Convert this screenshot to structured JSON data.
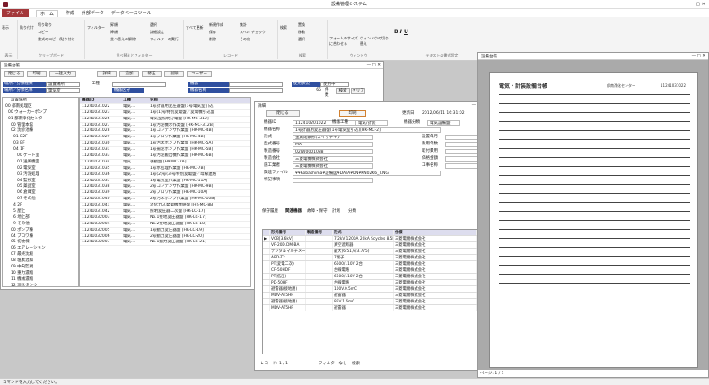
{
  "app": {
    "title": "設備管理システム"
  },
  "ribbon": {
    "tabs": [
      "ファイル",
      "ホーム",
      "作成",
      "外部データ",
      "データベースツール"
    ],
    "groups": [
      "表示",
      "クリップボード",
      "並べ替えとフィルター",
      "レコード",
      "検索",
      "ウィンドウ",
      "テキストの書式設定"
    ],
    "items": {
      "view": "表示",
      "paste": "貼り付け",
      "cut": "切り取り",
      "copy": "コピー",
      "format_painter": "書式のコピー/貼り付け",
      "filter": "フィルター",
      "ascending": "昇順",
      "descending": "降順",
      "remove_sort": "並べ替えの解除",
      "selection": "選択",
      "advanced": "詳細設定",
      "toggle_filter": "フィルターの実行",
      "refresh": "すべて更新",
      "new": "新規作成",
      "save": "保存",
      "delete": "削除",
      "totals": "集計",
      "spelling": "スペル チェック",
      "more": "その他",
      "find": "検索",
      "replace": "置換",
      "goto": "移動",
      "select": "選択",
      "fit_form": "フォームのサイズに合わせる",
      "switch_windows": "ウィンドウの切り替え"
    }
  },
  "status": {
    "text": "コマンドを入力してください。"
  },
  "list_window": {
    "title": "設備台帳",
    "buttons": [
      "閉じる",
      "印刷",
      "一括入力",
      "詳細",
      "追加",
      "修正",
      "削除",
      "ユーザー"
    ],
    "search": {
      "label1": "場所／分類種類",
      "value1": "設置場所",
      "label2": "場所／分類名称",
      "value2": "電気室",
      "label3": "工種",
      "value3": "",
      "label4": "機器",
      "label5": "機器区分",
      "label6": "機器名称",
      "label7": "使用状況",
      "value7": "使用中",
      "count_label": "件数",
      "count": "65",
      "btn_search": "検索",
      "btn_clear": "クリア"
    },
    "tree": [
      "設置場所",
      "00 都南処理区",
      "00 ウォーカーポンプ",
      "01 都南浄化センター",
      "00 管理本館",
      "02 沈砂池棟",
      "01 B2F",
      "03 BF",
      "04 1F",
      "00 ゲート室",
      "01 送風機室",
      "02 電気室",
      "03 汚泥処理",
      "04 監視室",
      "05 薬品室",
      "06 倉庫室",
      "07 その他",
      "4 2F",
      "5 屋上",
      "6 地上部",
      "9 その他",
      "00 ポンプ棟",
      "04 ブロワ棟",
      "05 初沈棟",
      "06 エアレーション",
      "07 最終沈殿",
      "08 塩素混和",
      "09 中央監視",
      "10 重力濃縮",
      "11 機械濃縮",
      "12 消化タンク"
    ],
    "grid_headers": [
      "機器ID",
      "工種",
      "名称"
    ],
    "grid": [
      [
        "11241031022",
        "電気...",
        "1号計器用変圧器盤(1号電気室引込)"
      ],
      [
        "11241031023",
        "電気...",
        "1号(1)号特別変電盤／変電機引込盤"
      ],
      [
        "11241031026",
        "電気...",
        "電気室照明分電盤 [HK-MC-312]"
      ],
      [
        "11241031027",
        "電気...",
        "1号汚泥機水作業盤 [HK-MC-312B]"
      ],
      [
        "11241031028",
        "電気...",
        "1号コンデンサ作業盤 [HK-MC-4B]"
      ],
      [
        "11241031029",
        "電気...",
        "1号ブロワ作業盤 [HK-MC-4B]"
      ],
      [
        "11241031030",
        "電気...",
        "1号汚水ポンプ作業盤 [HK-MC-5A]"
      ],
      [
        "11241031031",
        "電気...",
        "1号揚泥ポンプ作業盤 [HK-MC-5B]"
      ],
      [
        "11241031033",
        "電気...",
        "1号汚泥搬出機作業盤 [HK-MC-6B]"
      ],
      [
        "11241031034",
        "電気...",
        "手動盤 [HK-MC-7A]"
      ],
      [
        "11241031035",
        "電気...",
        "1号水処理作業盤 [HK-MC-7B]"
      ],
      [
        "11241031036",
        "電気...",
        "1号(2)号(3)号特別変電盤／母線連絡"
      ],
      [
        "11241031037",
        "電気...",
        "1号電気室作業盤 [HK-MC-11A]"
      ],
      [
        "11241031038",
        "電気...",
        "2号コンデンサ作業盤 [HK-MC-9B]"
      ],
      [
        "11241031039",
        "電気...",
        "2号ブロワ作業盤 [HK-MC-10A]"
      ],
      [
        "11241031040",
        "電気...",
        "2号汚水ポンプ作業盤 [HK-MC-10B]"
      ],
      [
        "11241031041",
        "電気...",
        "消化ガス発電機連絡盤 [HK-MC-8B]"
      ],
      [
        "11241031042",
        "電気...",
        "照明変圧器二次盤 [HK-LC-17]"
      ],
      [
        "11241032003",
        "電気...",
        "No.1接地変圧器盤 [HK-LC-17]"
      ],
      [
        "11241032004",
        "電気...",
        "No.2接地変圧器盤 [HK-LC-18]"
      ],
      [
        "11241032005",
        "電気...",
        "1号動力変圧器盤 [HK-LC-19]"
      ],
      [
        "11241032006",
        "電気...",
        "2号動力変圧器盤 [HK-LC-20]"
      ],
      [
        "11241032007",
        "電気...",
        "No.1動力変圧器盤 [HK-LC-21]"
      ]
    ]
  },
  "detail_window": {
    "title": "詳細",
    "close": "閉じる",
    "print": "印刷",
    "update": "更新日",
    "datetime": "2012/06/11 16:31:02",
    "fields": [
      [
        "機器ID",
        "112410201022"
      ],
      [
        "機器名称",
        "1号計器用変圧器盤(1号電気室引込)[HK-MC-2]"
      ],
      [
        "形式",
        "金属閉鎖形(スイッチギア"
      ],
      [
        "型式番号",
        "MX"
      ],
      [
        "製造番号",
        "02JW0001088"
      ],
      [
        "製造会社",
        "三菱電機株式会社"
      ],
      [
        "施工業者",
        "三菱電機株式会社"
      ],
      [
        "関連ファイル",
        "¥¥Kobashima¥設備図¥DATA¥KN¥KN02K6_T.NG"
      ],
      [
        "特記事項",
        ""
      ]
    ],
    "right_fields": [
      [
        "機器工種",
        "電気/計装"
      ],
      [
        "機器分類",
        "電気設備盤"
      ],
      [
        "設置年月",
        ""
      ],
      [
        "耐用年数",
        ""
      ],
      [
        "取付費用",
        ""
      ],
      [
        "価格金額",
        ""
      ],
      [
        "工事名称",
        ""
      ]
    ],
    "tabs": [
      "保守履歴",
      "関連機器",
      "故障・保守",
      "計測",
      "分類"
    ],
    "sub_headers": [
      "",
      "形式番号",
      "製造番号",
      "形式",
      "仕様",
      "製造会社"
    ],
    "sub_rows": [
      [
        "VCB[3.6kV]",
        "",
        "7.2kV 1200A 20kA Scycles 8.5kg",
        "三菱電機株式会社"
      ],
      [
        "VF-20D.DM-BA",
        "SR503",
        "真空遮断器",
        "三菱電機株式会社"
      ],
      [
        "デジタルマルチメータ",
        "",
        "最大(6/51,6/3.775)",
        "三菱電機株式会社"
      ],
      [
        "ARD-T2",
        "MP72",
        "7端子",
        "三菱電機株式会社"
      ],
      [
        "PT(変電二次)",
        "",
        "6600/110V 2台",
        "三菱電機株式会社"
      ],
      [
        "CF-50HDF",
        "45002/45006",
        "台線電路",
        "三菱電機株式会社"
      ],
      [
        "PT(低圧)",
        "",
        "6600/110V 2台",
        "三菱電機株式会社"
      ],
      [
        "PD-50HF",
        "45005/45106",
        "台線電路",
        "三菱電機株式会社"
      ],
      [
        "避雷器(接地用)",
        "",
        "100V.0.5mC",
        "三菱電機株式会社"
      ],
      [
        "MDV-AT5HR",
        "21PNEP23/136",
        "避雷器",
        "三菱電機株式会社"
      ],
      [
        "避雷器(接地用)",
        "",
        "85V.1.6mC",
        "三菱電機株式会社"
      ],
      [
        "MDV-AT5HR",
        "1940/15/164",
        "避雷器",
        "三菱電機株式会社"
      ]
    ],
    "nav": "レコード: 1 / 1",
    "nofilter": "フィルターなし",
    "search": "検索"
  },
  "report_window": {
    "title": "設備台帳",
    "heading": "電気・計装設備台帳",
    "org": "都南浄化センター",
    "sheet_id": "11241031022",
    "nav": "ページ: 1 / 1"
  }
}
